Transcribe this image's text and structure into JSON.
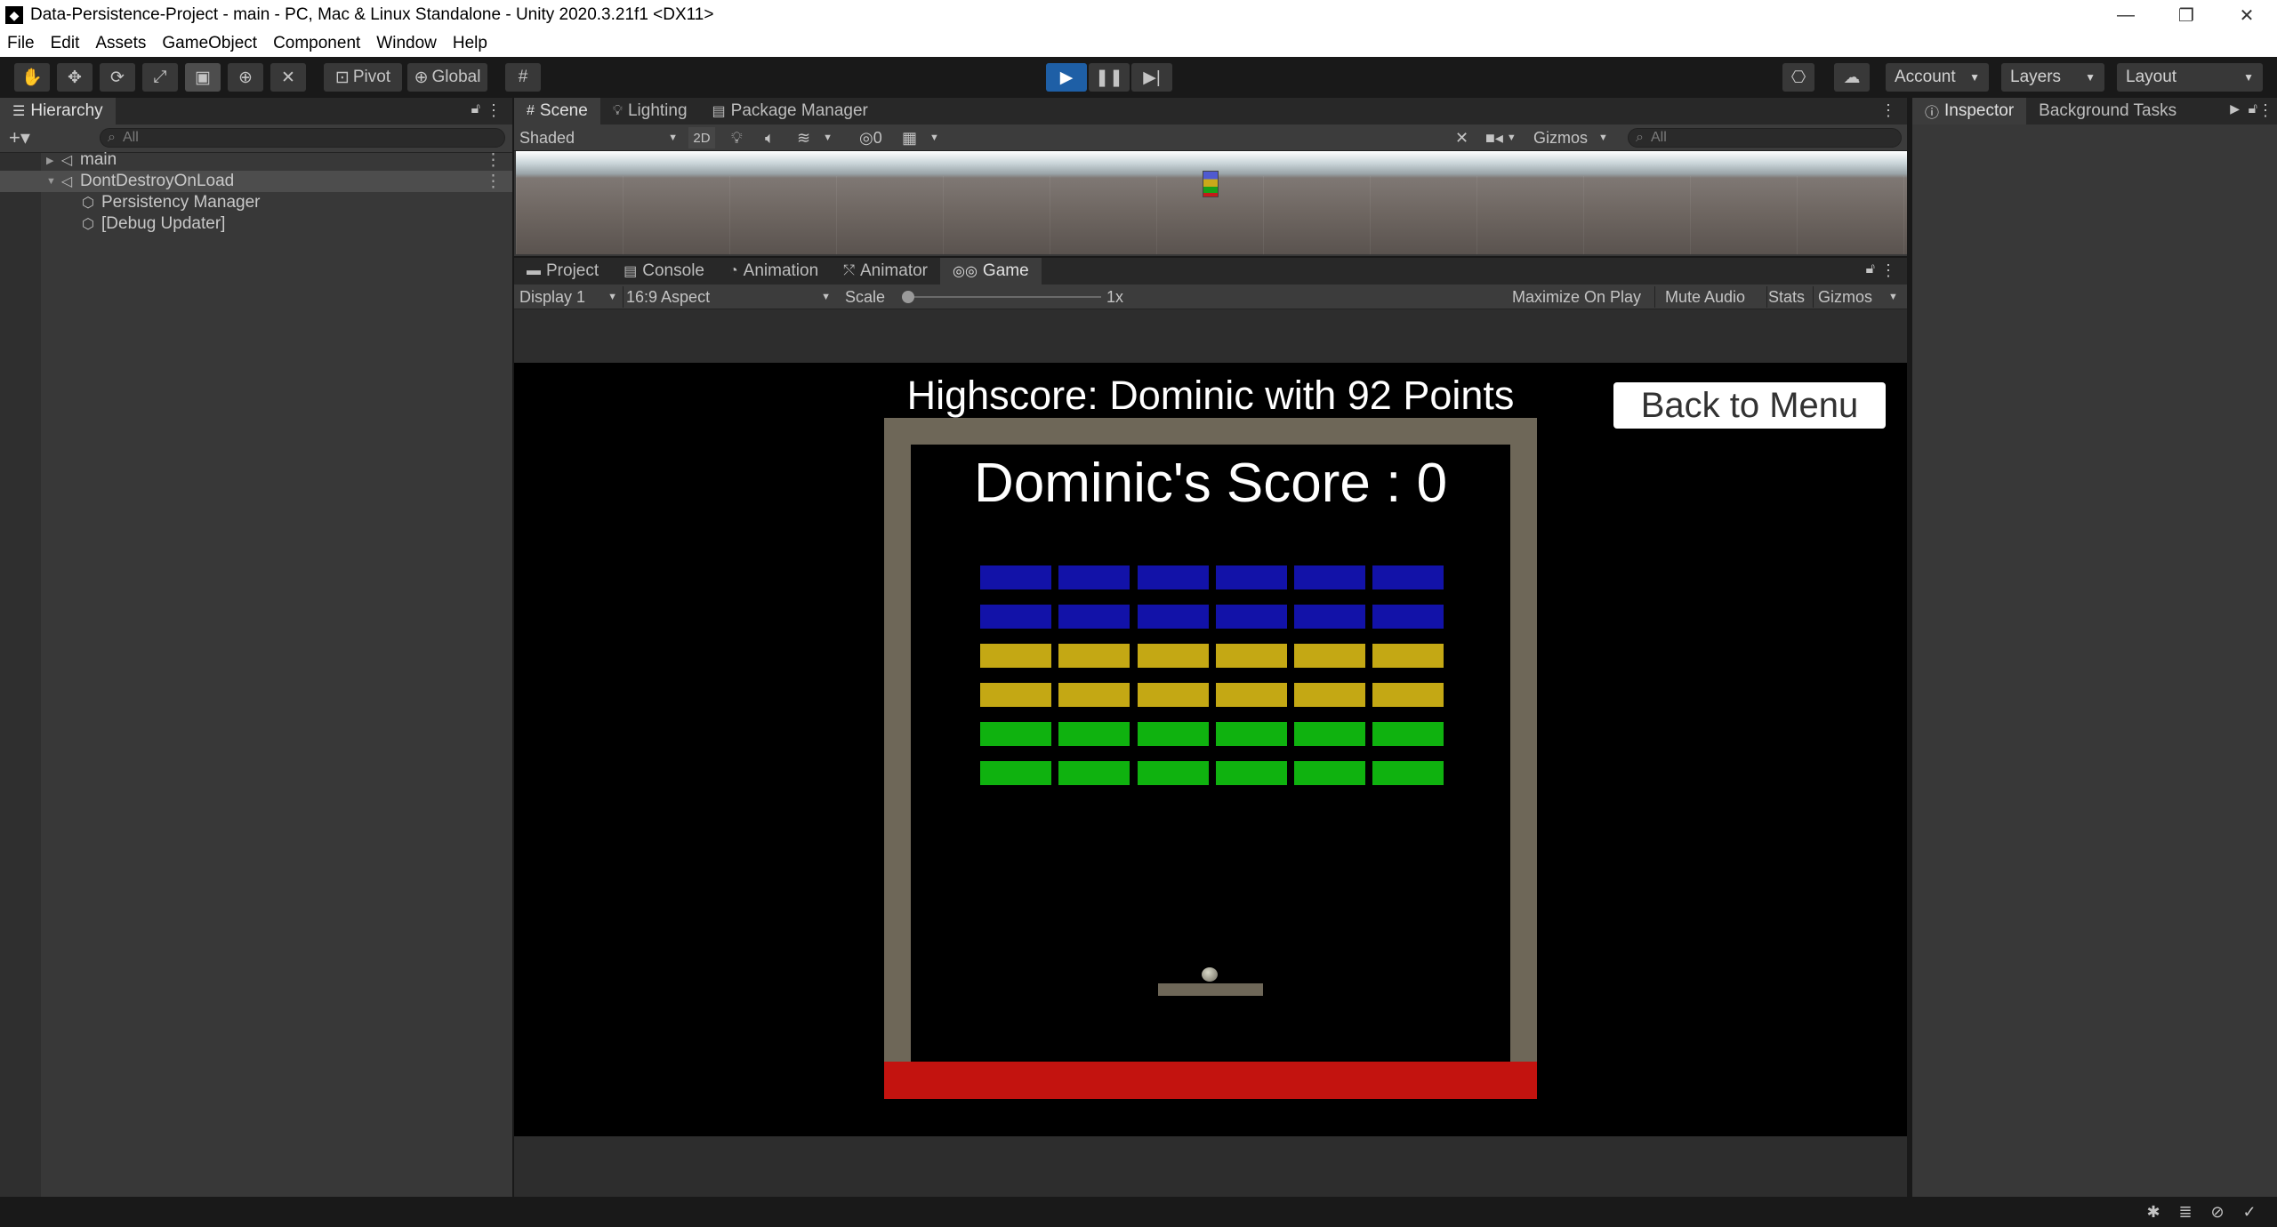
{
  "window": {
    "title": "Data-Persistence-Project - main - PC, Mac & Linux Standalone - Unity 2020.3.21f1 <DX11>",
    "minimize": "—",
    "maximize": "❐",
    "close": "✕"
  },
  "menu": [
    "File",
    "Edit",
    "Assets",
    "GameObject",
    "Component",
    "Window",
    "Help"
  ],
  "toolbar": {
    "pivot_label": "Pivot",
    "global_label": "Global",
    "account_label": "Account",
    "layers_label": "Layers",
    "layout_label": "Layout"
  },
  "hierarchy": {
    "tab_label": "Hierarchy",
    "search_placeholder": "All",
    "items": [
      {
        "label": "main"
      },
      {
        "label": "DontDestroyOnLoad"
      },
      {
        "label": "Persistency Manager"
      },
      {
        "label": "[Debug Updater]"
      }
    ]
  },
  "scene": {
    "tabs": [
      "Scene",
      "Lighting",
      "Package Manager"
    ],
    "shading": "Shaded",
    "mode_2d": "2D",
    "hidden_count": "0",
    "gizmos": "Gizmos",
    "search_placeholder": "All"
  },
  "game": {
    "tabs": [
      "Project",
      "Console",
      "Animation",
      "Animator",
      "Game"
    ],
    "display": "Display 1",
    "aspect": "16:9 Aspect",
    "scale_label": "Scale",
    "scale_value": "1x",
    "maximize": "Maximize On Play",
    "mute": "Mute Audio",
    "stats": "Stats",
    "gizmos": "Gizmos",
    "highscore_text": "Highscore: Dominic with 92 Points",
    "score_text": "Dominic's Score : 0",
    "back_button": "Back to Menu",
    "brick_colors": [
      "#1212a8",
      "#1212a8",
      "#c4a814",
      "#c4a814",
      "#0fb20f",
      "#0fb20f"
    ],
    "brick_rows": 6,
    "brick_cols": 6
  },
  "inspector": {
    "tabs": [
      "Inspector",
      "Background Tasks"
    ]
  },
  "colors": {
    "accent_play": "#1e5fa6",
    "death_zone": "#c3130f",
    "wall": "#6e6758"
  }
}
